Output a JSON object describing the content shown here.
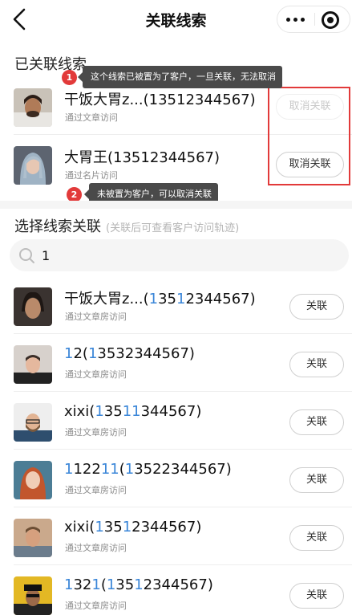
{
  "nav": {
    "title": "关联线索"
  },
  "linked": {
    "title": "已关联线索",
    "items": [
      {
        "name": "干饭大胃z...(13512344567)",
        "source": "通过文章访问",
        "action": "取消关联",
        "disabled": true
      },
      {
        "name": "大胃王(13512344567)",
        "source": "通过名片访问",
        "action": "取消关联",
        "disabled": false
      }
    ]
  },
  "tips": [
    {
      "num": "1",
      "text": "这个线索已被置为了客户，一旦关联，无法取消"
    },
    {
      "num": "2",
      "text": "未被置为客户，可以取消关联"
    }
  ],
  "select": {
    "title": "选择线索关联",
    "hint": "(关联后可查看客户访问轨迹)",
    "search_value": "1"
  },
  "candidates": [
    {
      "name_parts": [
        [
          "干饭大胃z...(",
          0
        ],
        [
          "1",
          1
        ],
        [
          "3",
          0
        ],
        [
          "5",
          0
        ],
        [
          "1",
          1
        ],
        [
          "2344567)",
          0
        ]
      ],
      "source": "通过文章房访问",
      "action": "关联"
    },
    {
      "name_parts": [
        [
          "1",
          1
        ],
        [
          "2(",
          0
        ],
        [
          "1",
          1
        ],
        [
          "3532344567)",
          0
        ]
      ],
      "source": "通过文章房访问",
      "action": "关联"
    },
    {
      "name_parts": [
        [
          "xixi(",
          0
        ],
        [
          "1",
          1
        ],
        [
          "35",
          0
        ],
        [
          "11",
          1
        ],
        [
          "344567)",
          0
        ]
      ],
      "source": "通过文章房访问",
      "action": "关联"
    },
    {
      "name_parts": [
        [
          "1",
          1
        ],
        [
          "122",
          0
        ],
        [
          "11",
          1
        ],
        [
          "(",
          0
        ],
        [
          "1",
          1
        ],
        [
          "3522344567)",
          0
        ]
      ],
      "source": "通过文章房访问",
      "action": "关联"
    },
    {
      "name_parts": [
        [
          "xixi(",
          0
        ],
        [
          "1",
          1
        ],
        [
          "35",
          0
        ],
        [
          "1",
          1
        ],
        [
          "2344567)",
          0
        ]
      ],
      "source": "通过文章房访问",
      "action": "关联"
    },
    {
      "name_parts": [
        [
          "1",
          1
        ],
        [
          "32",
          0
        ],
        [
          "1",
          1
        ],
        [
          "(",
          0
        ],
        [
          "1",
          1
        ],
        [
          "35",
          0
        ],
        [
          "1",
          1
        ],
        [
          "2344567)",
          0
        ]
      ],
      "source": "通过文章房访问",
      "action": "关联"
    }
  ],
  "colors": {
    "highlight": "#3a86d8",
    "alert": "#e23a3a",
    "tooltip": "#4a4a4a"
  },
  "icons": [
    "back-arrow-icon",
    "more-dots-icon",
    "close-circle-icon",
    "search-icon",
    "avatar-photo"
  ]
}
